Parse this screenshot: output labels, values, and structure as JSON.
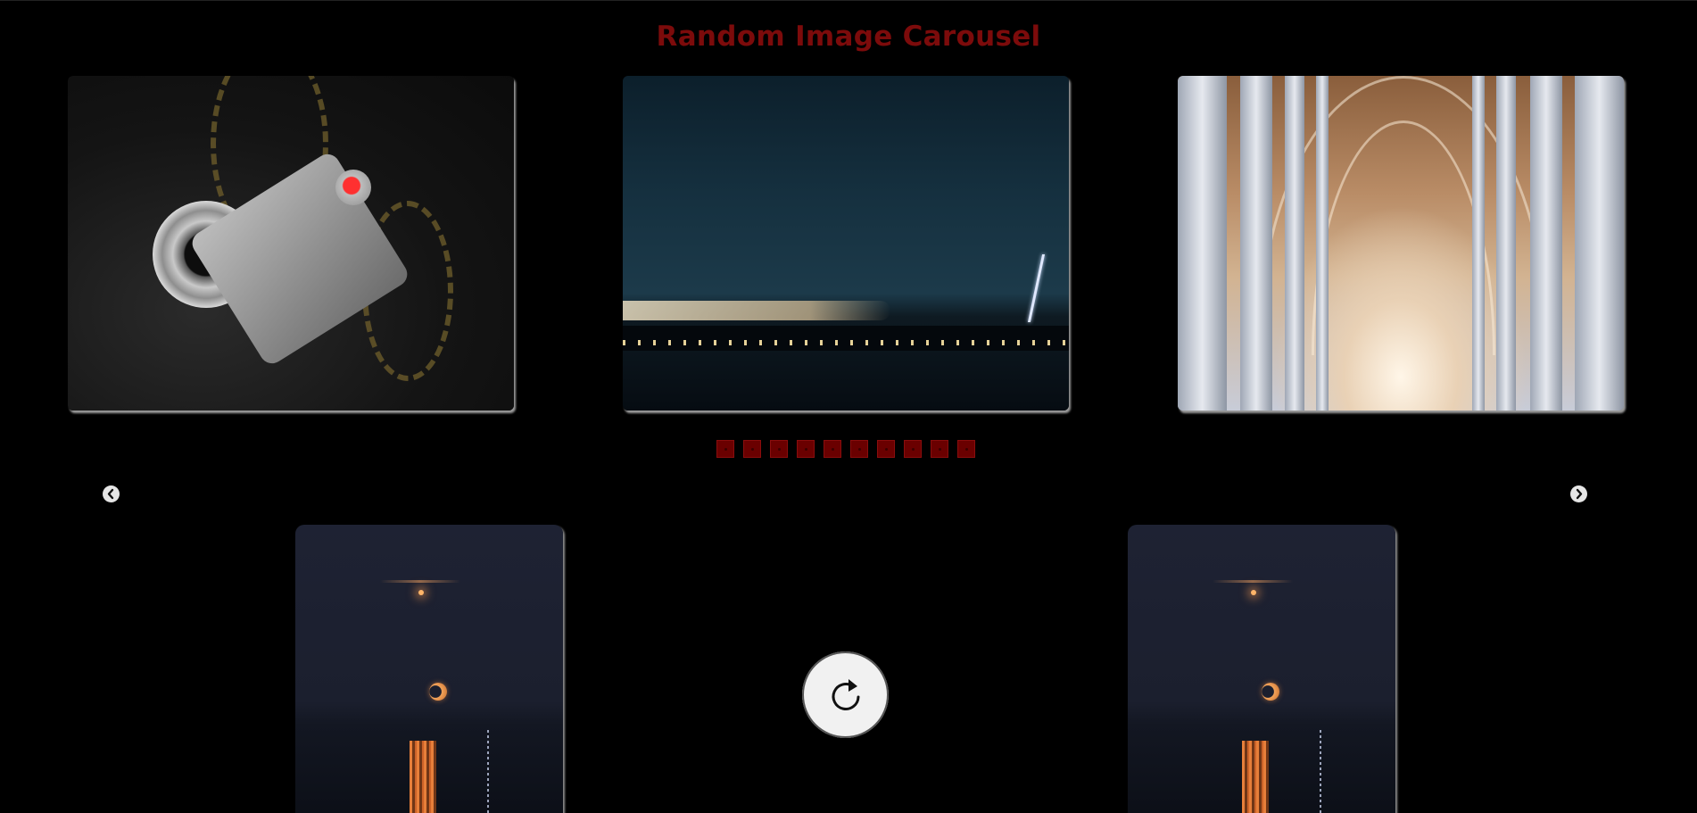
{
  "page": {
    "title": "Random Image Carousel"
  },
  "carousel": {
    "slides": [
      {
        "subject": "camera"
      },
      {
        "subject": "night-lightning"
      },
      {
        "subject": "cathedral-arches"
      }
    ],
    "pagination_count": 10,
    "prev_icon": "chevron-left-circle-icon",
    "next_icon": "chevron-right-circle-icon"
  },
  "gallery": {
    "cards": [
      {
        "subject": "moon-over-water"
      },
      {
        "subject": "moon-over-water"
      }
    ]
  },
  "refresh": {
    "icon": "refresh-icon"
  },
  "colors": {
    "background": "#000000",
    "title": "#7c0b0b",
    "dot": "#6a0000"
  }
}
